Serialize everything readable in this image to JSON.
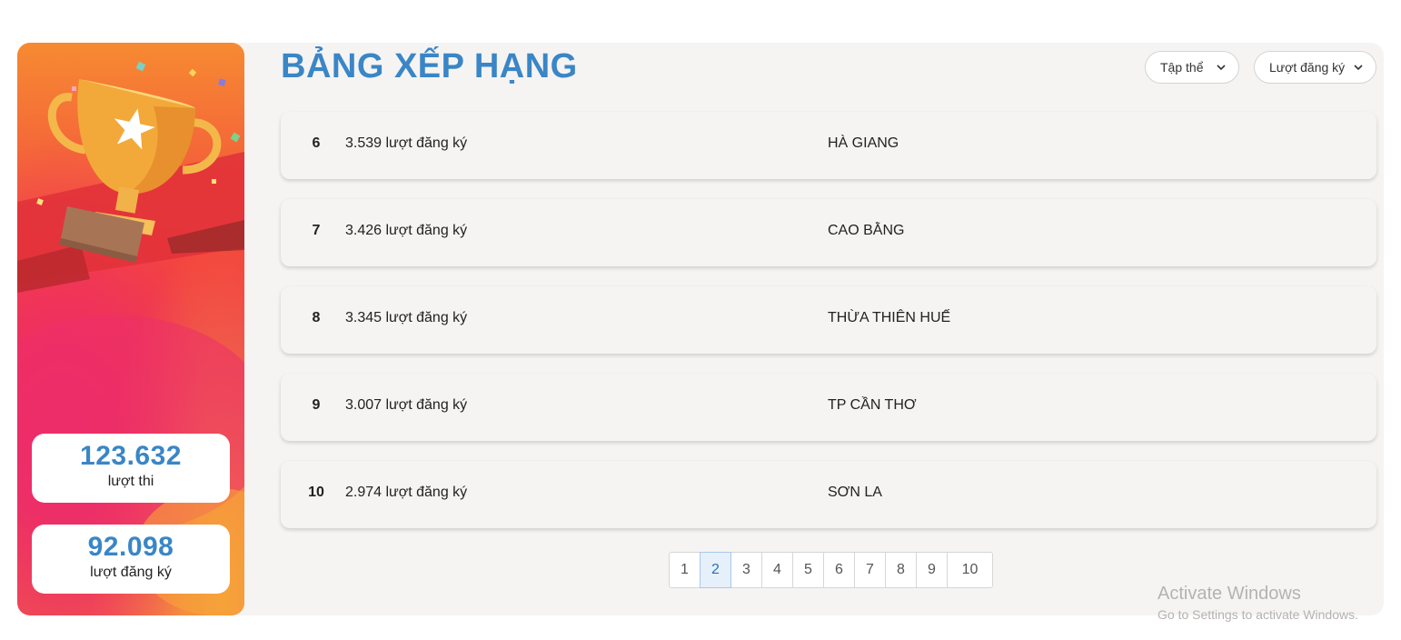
{
  "stats": {
    "attempts_value": "123.632",
    "attempts_label": "lượt thi",
    "registrations_value": "92.098",
    "registrations_label": "lượt đăng ký"
  },
  "header": {
    "title": "BẢNG XẾP HẠNG",
    "filter_group": "Tập thể",
    "filter_sort": "Lượt đăng ký"
  },
  "rows": [
    {
      "rank": "6",
      "score": "3.539 lượt đăng ký",
      "name": "HÀ GIANG"
    },
    {
      "rank": "7",
      "score": "3.426 lượt đăng ký",
      "name": "CAO BẰNG"
    },
    {
      "rank": "8",
      "score": "3.345 lượt đăng ký",
      "name": "THỪA THIÊN HUẾ"
    },
    {
      "rank": "9",
      "score": "3.007 lượt đăng ký",
      "name": "TP CẦN THƠ"
    },
    {
      "rank": "10",
      "score": "2.974 lượt đăng ký",
      "name": "SƠN LA"
    }
  ],
  "pagination": {
    "pages": [
      "1",
      "2",
      "3",
      "4",
      "5",
      "6",
      "7",
      "8",
      "9",
      "10"
    ],
    "current": "2"
  },
  "watermark": {
    "line1": "Activate Windows",
    "line2": "Go to Settings to activate Windows."
  },
  "colors": {
    "accent": "#3a86c6",
    "panel_bg": "#f5f4f3",
    "trophy_gold": "#f2a93a"
  }
}
